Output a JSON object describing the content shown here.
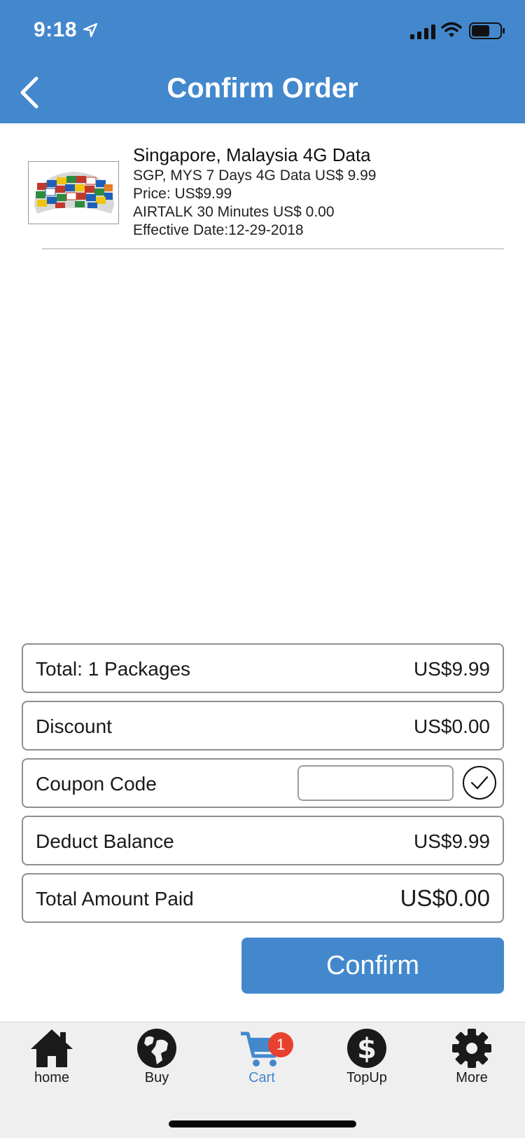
{
  "status_bar": {
    "time": "9:18"
  },
  "header": {
    "title": "Confirm Order"
  },
  "product": {
    "title": "Singapore, Malaysia 4G Data",
    "lines": [
      "SGP, MYS 7 Days 4G Data US$ 9.99",
      "Price: US$9.99",
      "AIRTALK 30 Minutes US$ 0.00",
      "Effective Date:12-29-2018"
    ]
  },
  "summary": {
    "total_label": "Total: 1 Packages",
    "total_value": "US$9.99",
    "discount_label": "Discount",
    "discount_value": "US$0.00",
    "coupon_label": "Coupon Code",
    "coupon_value": "",
    "deduct_label": "Deduct Balance",
    "deduct_value": "US$9.99",
    "paid_label": "Total Amount Paid",
    "paid_value": "US$0.00"
  },
  "confirm_label": "Confirm",
  "tabs": [
    {
      "label": "home",
      "icon": "home-icon"
    },
    {
      "label": "Buy",
      "icon": "globe-icon"
    },
    {
      "label": "Cart",
      "icon": "cart-icon",
      "active": true,
      "badge": "1"
    },
    {
      "label": "TopUp",
      "icon": "dollar-icon"
    },
    {
      "label": "More",
      "icon": "gear-icon"
    }
  ],
  "colors": {
    "primary": "#4388cd",
    "badge": "#e8412f"
  }
}
